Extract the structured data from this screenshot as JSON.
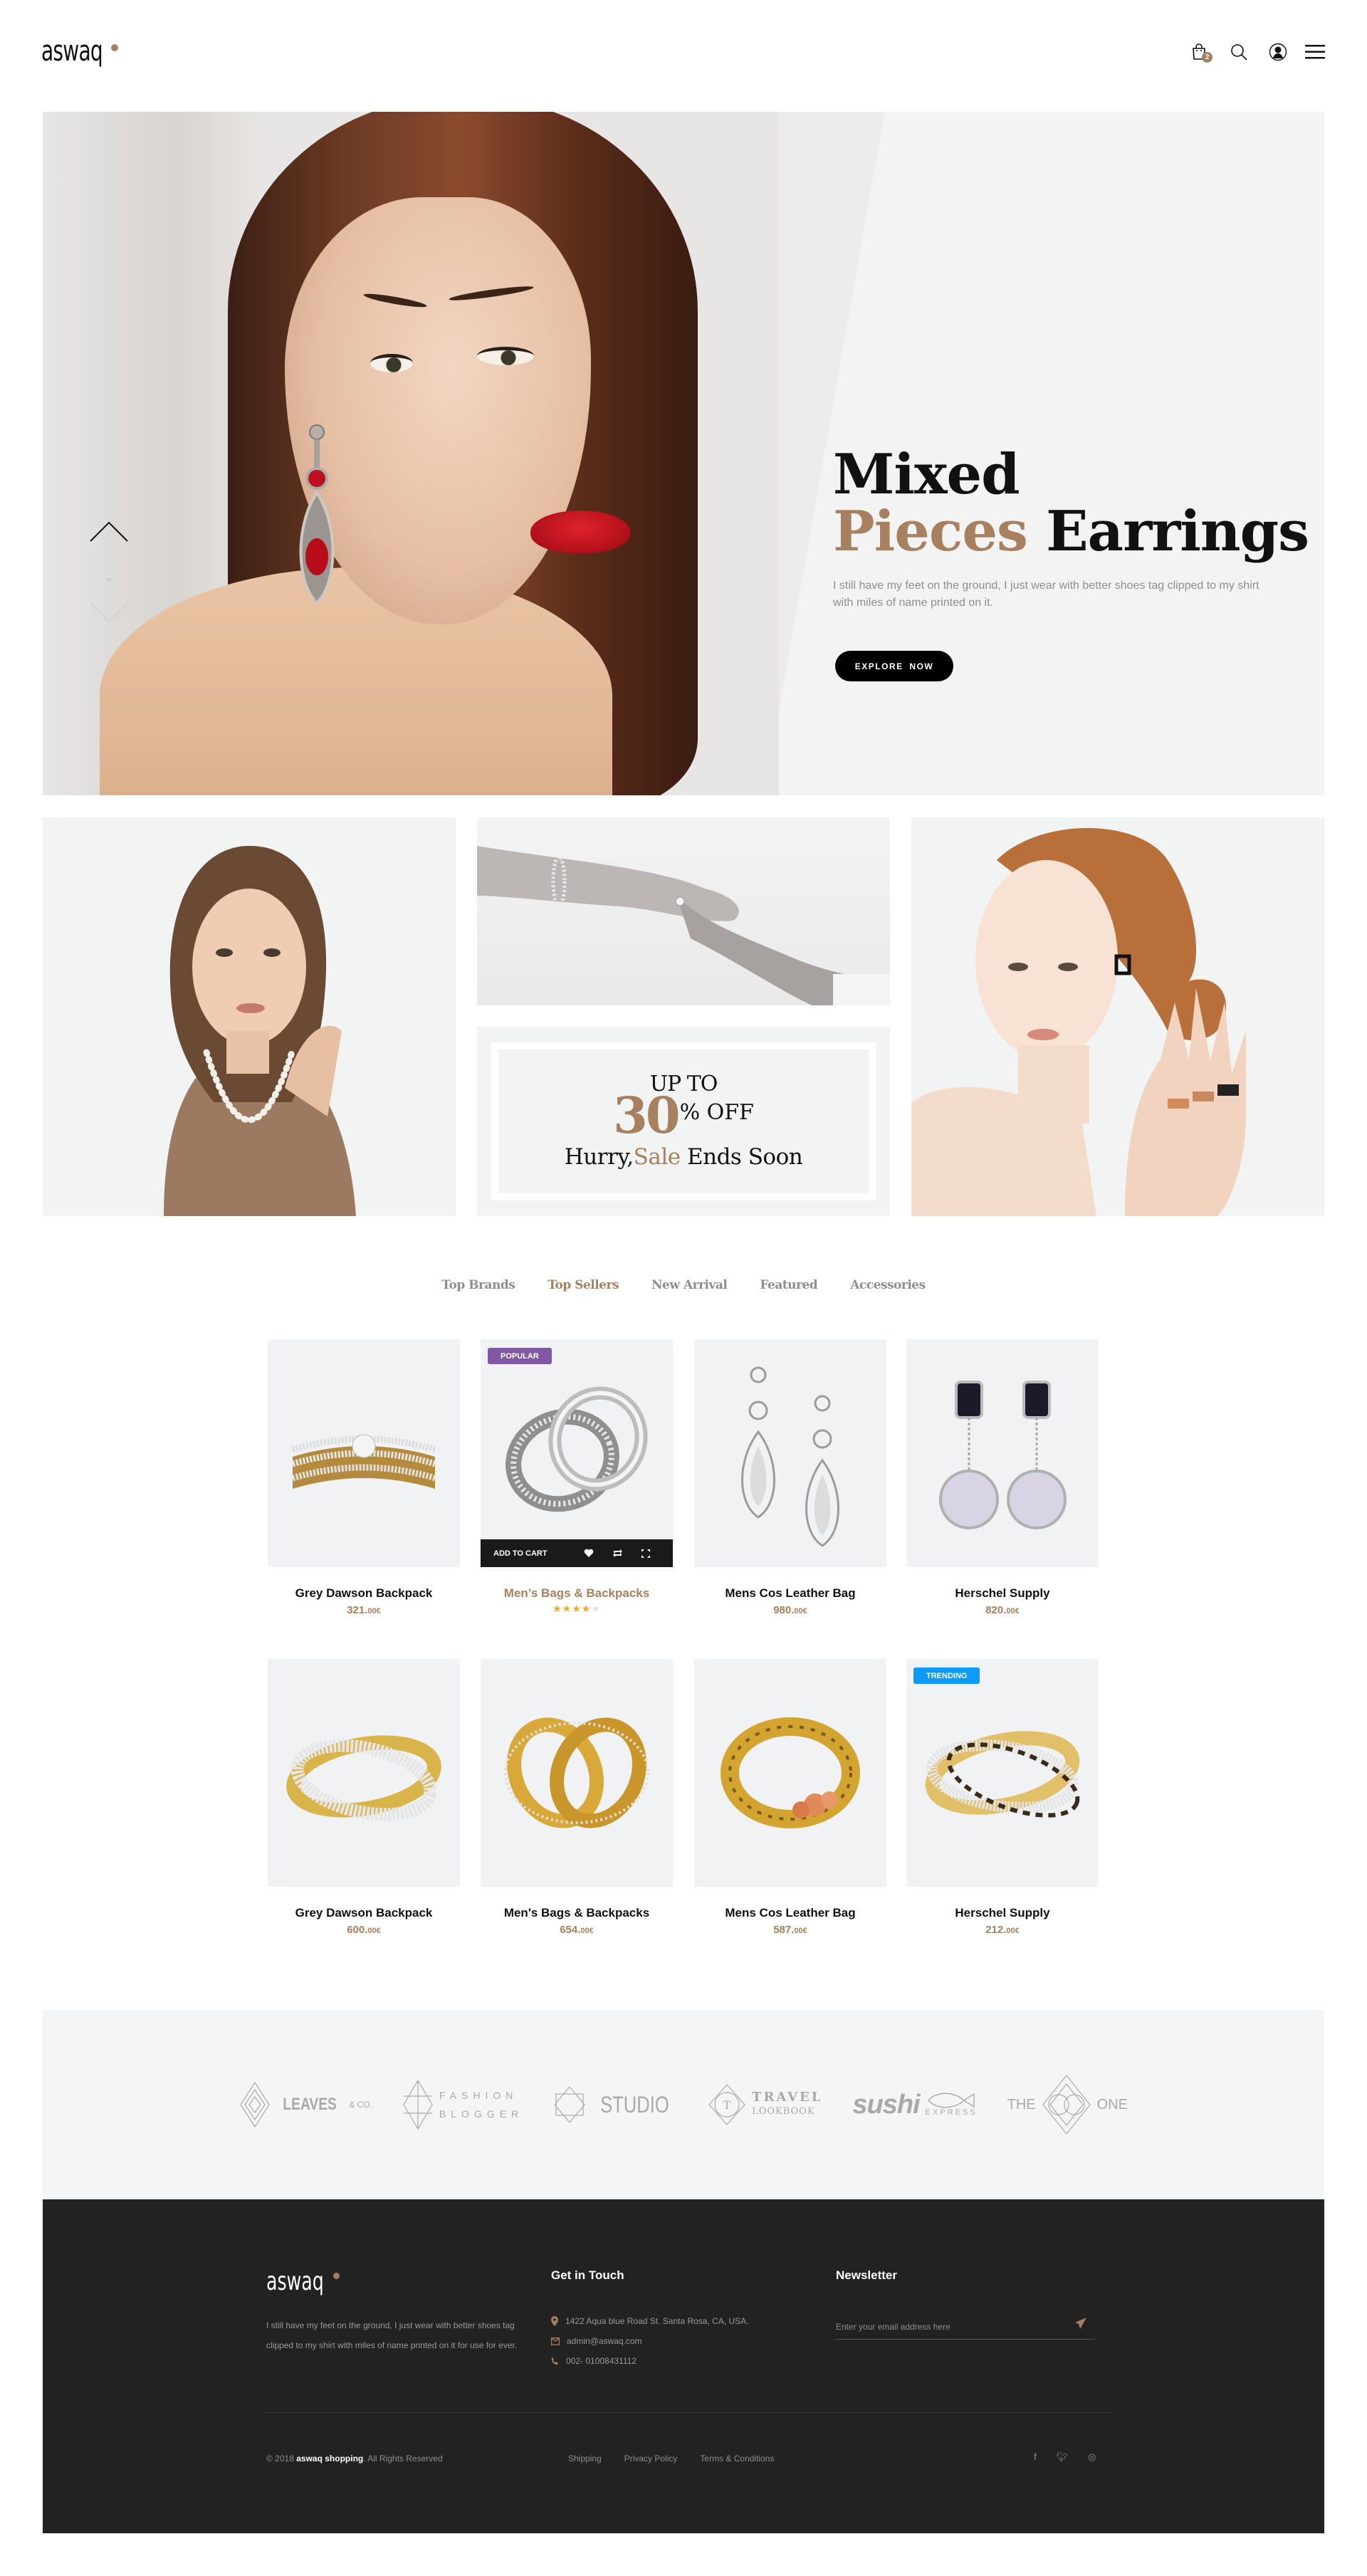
{
  "header": {
    "logo": "aswaq",
    "cart_count": "2",
    "icons": [
      "shopping-bag-icon",
      "search-icon",
      "user-icon",
      "menu-icon"
    ]
  },
  "hero": {
    "title_line1": "Mixed",
    "title_accent": "Pieces",
    "title_rest": "Earrings",
    "description": "I still have my feet on the ground, I just wear with better shoes tag clipped to my shirt with miles of name printed on it.",
    "cta_label": "EXPLORE  NOW"
  },
  "sale_banner": {
    "up_to": "UP TO",
    "percent": "30",
    "off": "% OFF",
    "hurry_prefix": "Hurry,",
    "hurry_accent": "Sale",
    "hurry_suffix": " Ends Soon"
  },
  "tabs": [
    {
      "label": "Top Brands",
      "active": false
    },
    {
      "label": "Top Sellers",
      "active": true
    },
    {
      "label": "New Arrival",
      "active": false
    },
    {
      "label": "Featured",
      "active": false
    },
    {
      "label": "Accessories",
      "active": false
    }
  ],
  "products": [
    {
      "name": "Grey Dawson Backpack",
      "price_main": "321.",
      "price_cents": "00€",
      "tag": ""
    },
    {
      "name": "Men’s Bags & Backpacks",
      "rating": 4,
      "rating_max": 5,
      "tag": "POPULAR",
      "hovered": true
    },
    {
      "name": "Mens Cos Leather Bag",
      "price_main": "980.",
      "price_cents": "00€",
      "tag": ""
    },
    {
      "name": "Herschel Supply",
      "price_main": "820.",
      "price_cents": "00€",
      "tag": ""
    },
    {
      "name": "Grey Dawson Backpack",
      "price_main": "600.",
      "price_cents": "00€",
      "tag": ""
    },
    {
      "name": "Men's Bags & Backpacks",
      "price_main": "654.",
      "price_cents": "00€",
      "tag": ""
    },
    {
      "name": "Mens Cos Leather Bag",
      "price_main": "587.",
      "price_cents": "00€",
      "tag": ""
    },
    {
      "name": "Herschel Supply",
      "price_main": "212.",
      "price_cents": "00€",
      "tag": "TRENDING"
    }
  ],
  "product_actions": {
    "add_to_cart": "ADD TO CART"
  },
  "brands": [
    {
      "name": "LEAVES",
      "sub": "& CO."
    },
    {
      "name": "FASHION",
      "sub": "BLOGGER"
    },
    {
      "name": "STUDIO",
      "sub": ""
    },
    {
      "name": "TRAVEL",
      "sub": "LOOKBOOK"
    },
    {
      "name": "sushi",
      "sub": "EXPRESS"
    },
    {
      "name": "THE",
      "sub": "ONE"
    }
  ],
  "footer": {
    "logo": "aswaq",
    "about": "I still have my feet on the ground, I just wear with better shoes tag clipped to my shirt with miles of name printed on it for use for ever.",
    "contact_heading": "Get in Touch",
    "address": "1422 Aqua blue Road St. Santa Rosa, CA, USA.",
    "email": "admin@aswaq.com",
    "phone": "002- 01008431112",
    "newsletter_heading": "Newsletter",
    "newsletter_placeholder": "Enter your email address here",
    "copyright_prefix": "© 2018 ",
    "copyright_brand": "aswaq shopping",
    "copyright_suffix": ". All Rights Reserved",
    "links": [
      "Shipping",
      "Privacy Policy",
      "Terms & Conditions"
    ],
    "social": [
      "facebook-icon",
      "twitter-icon",
      "instagram-icon"
    ]
  },
  "colors": {
    "accent": "#a6805f",
    "popular_tag": "#8257a4",
    "trending_tag": "#0c9bfb",
    "footer_bg": "#222222",
    "brands_bg": "#f4f5f7",
    "star": "#f5a623"
  }
}
